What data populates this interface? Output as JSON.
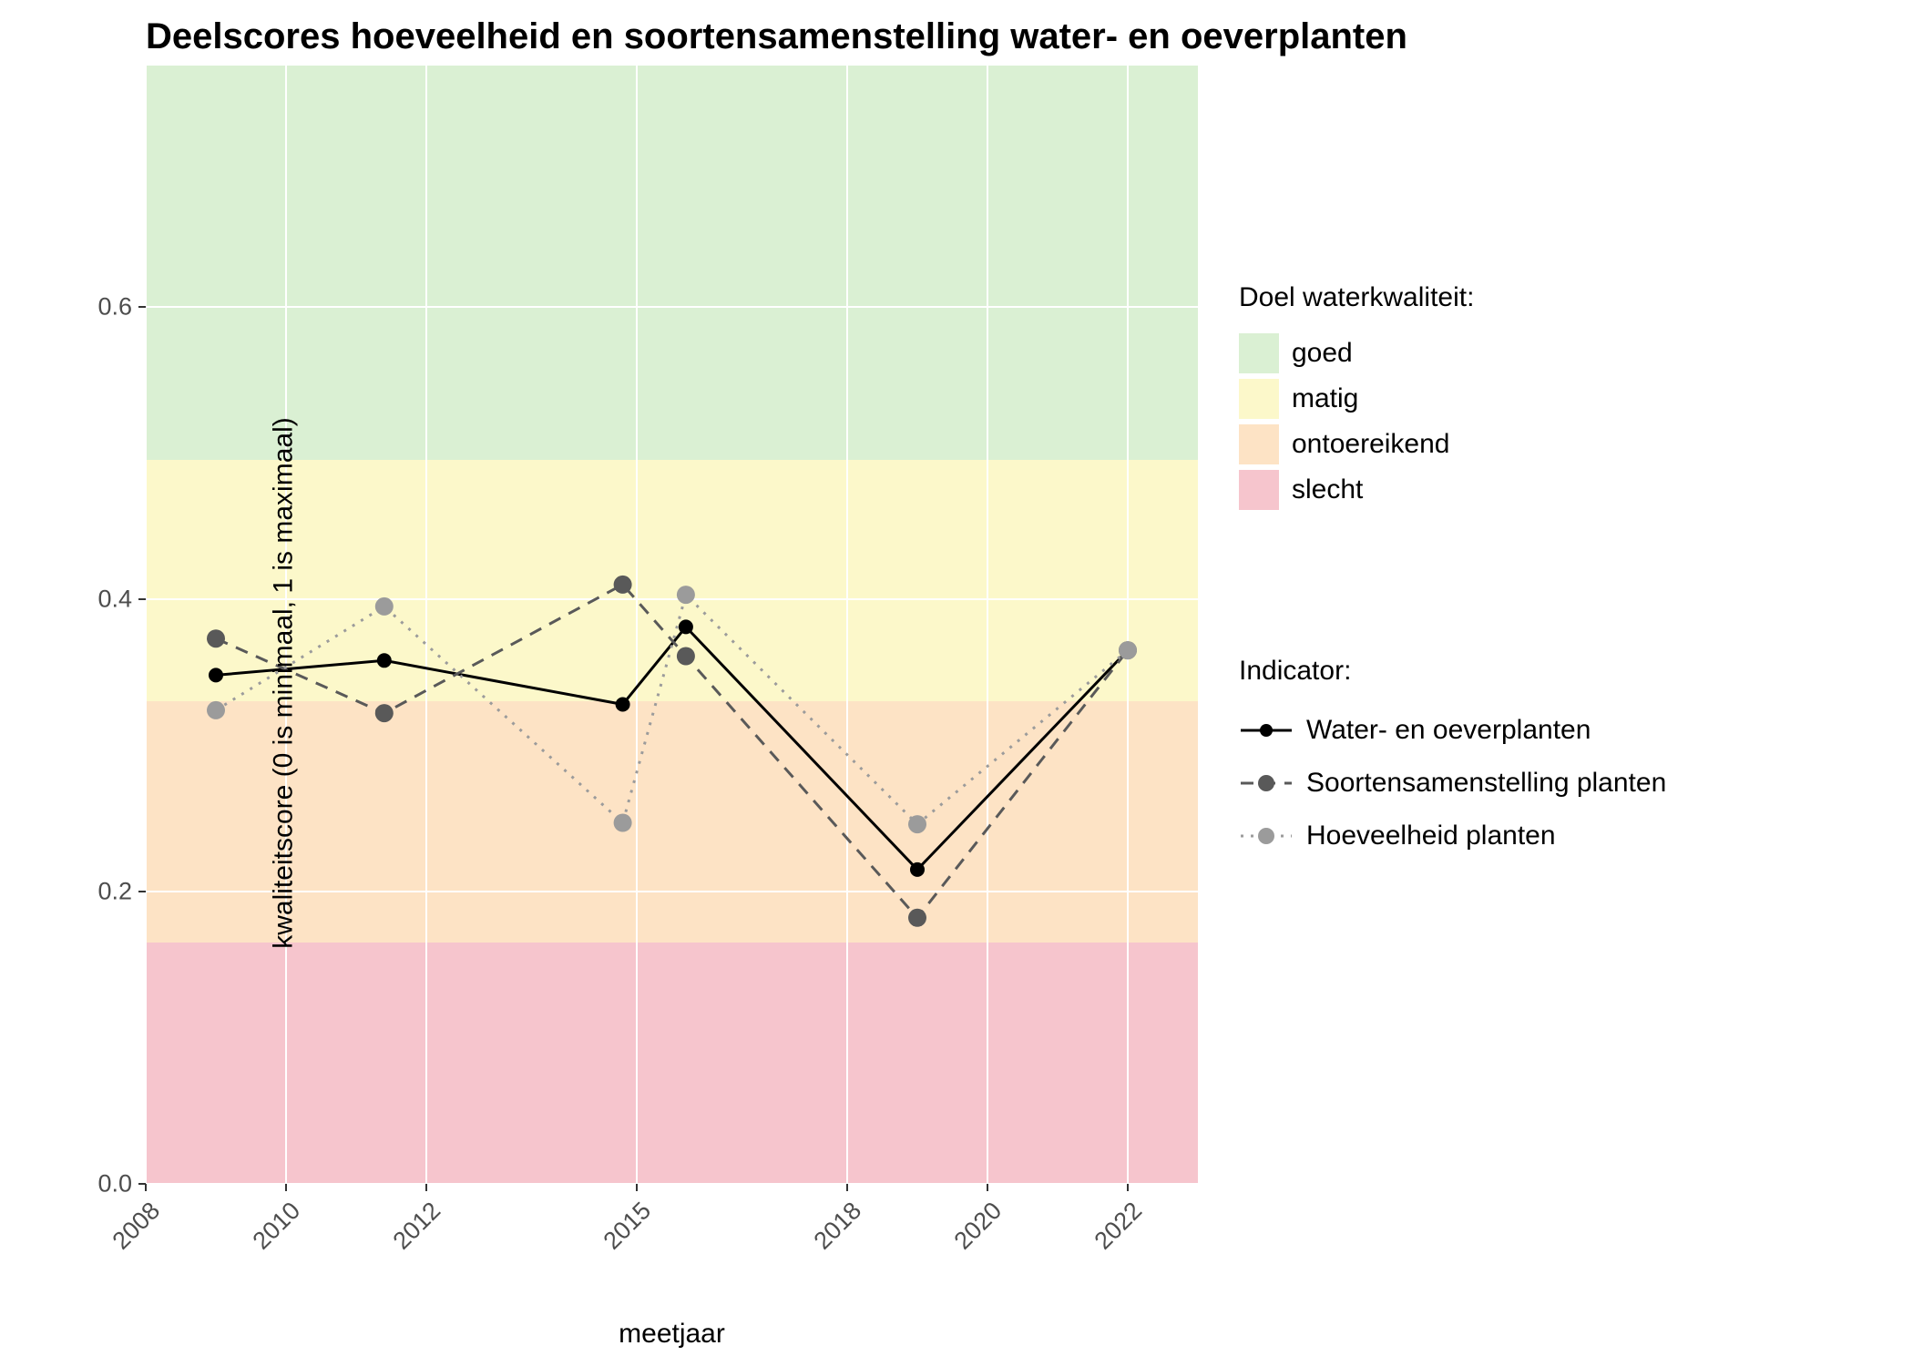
{
  "chart_data": {
    "type": "line",
    "title": "Deelscores hoeveelheid en soortensamenstelling water- en oeverplanten",
    "xlabel": "meetjaar",
    "ylabel": "kwaliteitscore (0 is minimaal, 1 is maximaal)",
    "x_ticks": [
      2008,
      2010,
      2012,
      2015,
      2018,
      2020,
      2022
    ],
    "y_ticks": [
      0.0,
      0.2,
      0.4,
      0.6
    ],
    "xlim": [
      2008,
      2023
    ],
    "ylim": [
      0.0,
      0.765
    ],
    "bands": [
      {
        "name": "slecht",
        "from": 0.0,
        "to": 0.165,
        "color": "#f6c5cd"
      },
      {
        "name": "ontoereikend",
        "from": 0.165,
        "to": 0.33,
        "color": "#fde3c5"
      },
      {
        "name": "matig",
        "from": 0.33,
        "to": 0.495,
        "color": "#fcf8ca"
      },
      {
        "name": "goed",
        "from": 0.495,
        "to": 0.765,
        "color": "#daf0d3"
      }
    ],
    "series": [
      {
        "name": "Water- en oeverplanten",
        "style": "solid",
        "color": "#000000",
        "x": [
          2009,
          2011.4,
          2014.8,
          2015.7,
          2019,
          2022
        ],
        "y": [
          0.348,
          0.358,
          0.328,
          0.381,
          0.215,
          0.365
        ]
      },
      {
        "name": "Soortensamenstelling planten",
        "style": "dashed",
        "color": "#595959",
        "x": [
          2009,
          2011.4,
          2014.8,
          2015.7,
          2019,
          2022
        ],
        "y": [
          0.373,
          0.322,
          0.41,
          0.361,
          0.182,
          0.365
        ]
      },
      {
        "name": "Hoeveelheid planten",
        "style": "dotted",
        "color": "#9b9b9b",
        "x": [
          2009,
          2011.4,
          2014.8,
          2015.7,
          2019,
          2022
        ],
        "y": [
          0.324,
          0.395,
          0.247,
          0.403,
          0.246,
          0.365
        ]
      }
    ],
    "legend_bands_title": "Doel waterkwaliteit:",
    "legend_bands": [
      {
        "label": "goed",
        "color": "#daf0d3"
      },
      {
        "label": "matig",
        "color": "#fcf8ca"
      },
      {
        "label": "ontoereikend",
        "color": "#fde3c5"
      },
      {
        "label": "slecht",
        "color": "#f6c5cd"
      }
    ],
    "legend_series_title": "Indicator:"
  }
}
